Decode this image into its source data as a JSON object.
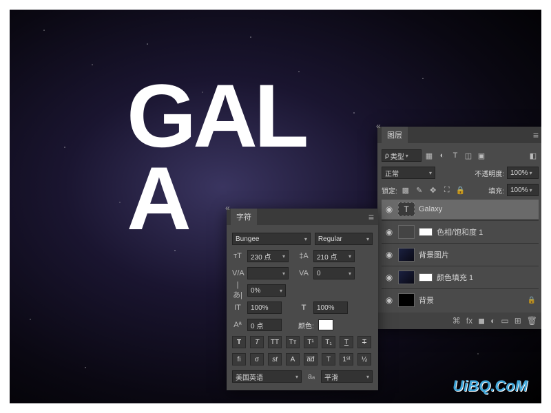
{
  "canvas": {
    "text_line1": "GAL",
    "text_line2": "A"
  },
  "watermark": "UiBQ.CoM",
  "layersPanel": {
    "title": "图层",
    "filterMode": "类型",
    "blendMode": "正常",
    "opacityLabel": "不透明度:",
    "opacityValue": "100%",
    "lockLabel": "锁定:",
    "fillLabel": "填充:",
    "fillValue": "100%",
    "layers": [
      {
        "name": "Galaxy",
        "type": "text",
        "selected": true
      },
      {
        "name": "色相/饱和度 1",
        "type": "adj"
      },
      {
        "name": "背景图片",
        "type": "img"
      },
      {
        "name": "颜色填充 1",
        "type": "fill"
      },
      {
        "name": "背景",
        "type": "bg",
        "locked": true
      }
    ]
  },
  "charPanel": {
    "title": "字符",
    "font": "Bungee",
    "style": "Regular",
    "size": "230 点",
    "leading": "210 点",
    "tracking": "0",
    "kerning": "",
    "height": "0%",
    "vscale": "100%",
    "hscale": "100%",
    "baseline": "0 点",
    "colorLabel": "颜色:",
    "lang": "美国英语",
    "aa": "平滑"
  }
}
